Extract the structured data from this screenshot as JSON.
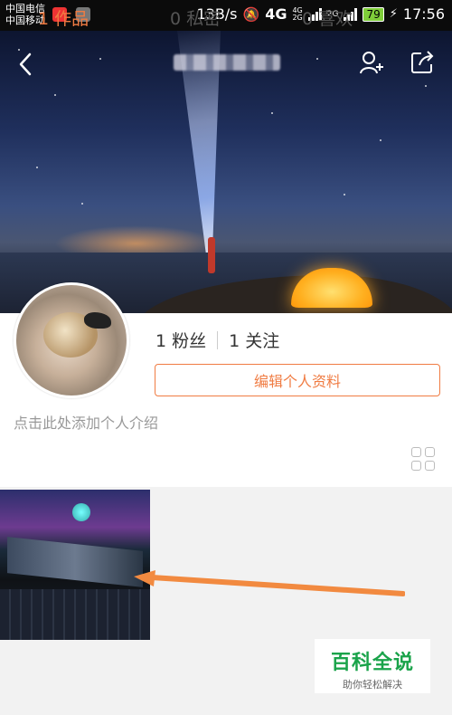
{
  "status_bar": {
    "carrier_1": "中国电信",
    "carrier_2": "中国移动",
    "net_speed": "13B/s",
    "network_type": "4G",
    "network_small_top": "4G",
    "network_small_bottom": "2G",
    "network_small_top_2": "2G",
    "battery_level": "79",
    "time": "17:56"
  },
  "header": {
    "back_icon": "chevron-left-icon",
    "add_friend_icon": "add-user-icon",
    "share_icon": "share-icon"
  },
  "profile": {
    "fans_count": "1",
    "fans_label": "粉丝",
    "follow_count": "1",
    "follow_label": "关注",
    "edit_profile_label": "编辑个人资料",
    "intro_placeholder": "点击此处添加个人介绍"
  },
  "tabs": [
    {
      "count": "1",
      "label": "作品",
      "active": true
    },
    {
      "count": "0",
      "label": "私密",
      "active": false
    },
    {
      "count": "0",
      "label": "喜欢",
      "active": false
    }
  ],
  "colors": {
    "accent": "#f07c43",
    "watermark_green": "#1aa34a",
    "arrow": "#f28a40"
  },
  "watermark": {
    "title": "百科全说",
    "subtitle": "助你轻松解决"
  }
}
